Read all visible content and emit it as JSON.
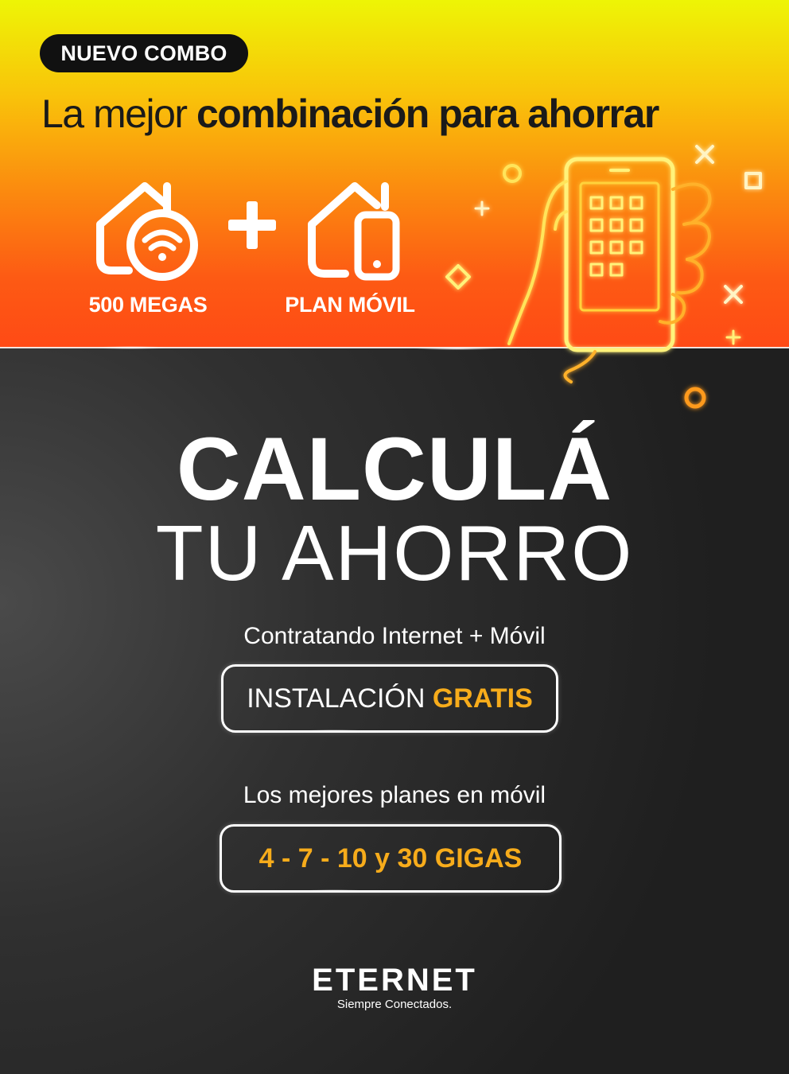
{
  "badge": {
    "label": "NUEVO COMBO"
  },
  "headline": {
    "light": "La mejor",
    "strong": "combinación para ahorrar"
  },
  "services": [
    {
      "label": "500 MEGAS",
      "icon": "home-wifi-icon"
    },
    {
      "label": "PLAN MÓVIL",
      "icon": "home-phone-icon"
    }
  ],
  "plus_icon": "plus-icon",
  "illustration": "neon-hand-phone-icon",
  "calc": {
    "title": "CALCULÁ",
    "subtitle": "TU AHORRO"
  },
  "offer1": {
    "caption": "Contratando Internet + Móvil",
    "pill_text": "INSTALACIÓN",
    "pill_accent": "GRATIS"
  },
  "offer2": {
    "caption": "Los mejores planes en móvil",
    "pill_text": "4 - 7 - 10 y 30 GIGAS"
  },
  "brand": {
    "name": "ETERNET",
    "tagline": "Siempre Conectados."
  },
  "colors": {
    "accent": "#f7ac1b",
    "dark": "#111111",
    "neon_yellow": "#fff27a",
    "neon_orange": "#ff9a1f"
  }
}
